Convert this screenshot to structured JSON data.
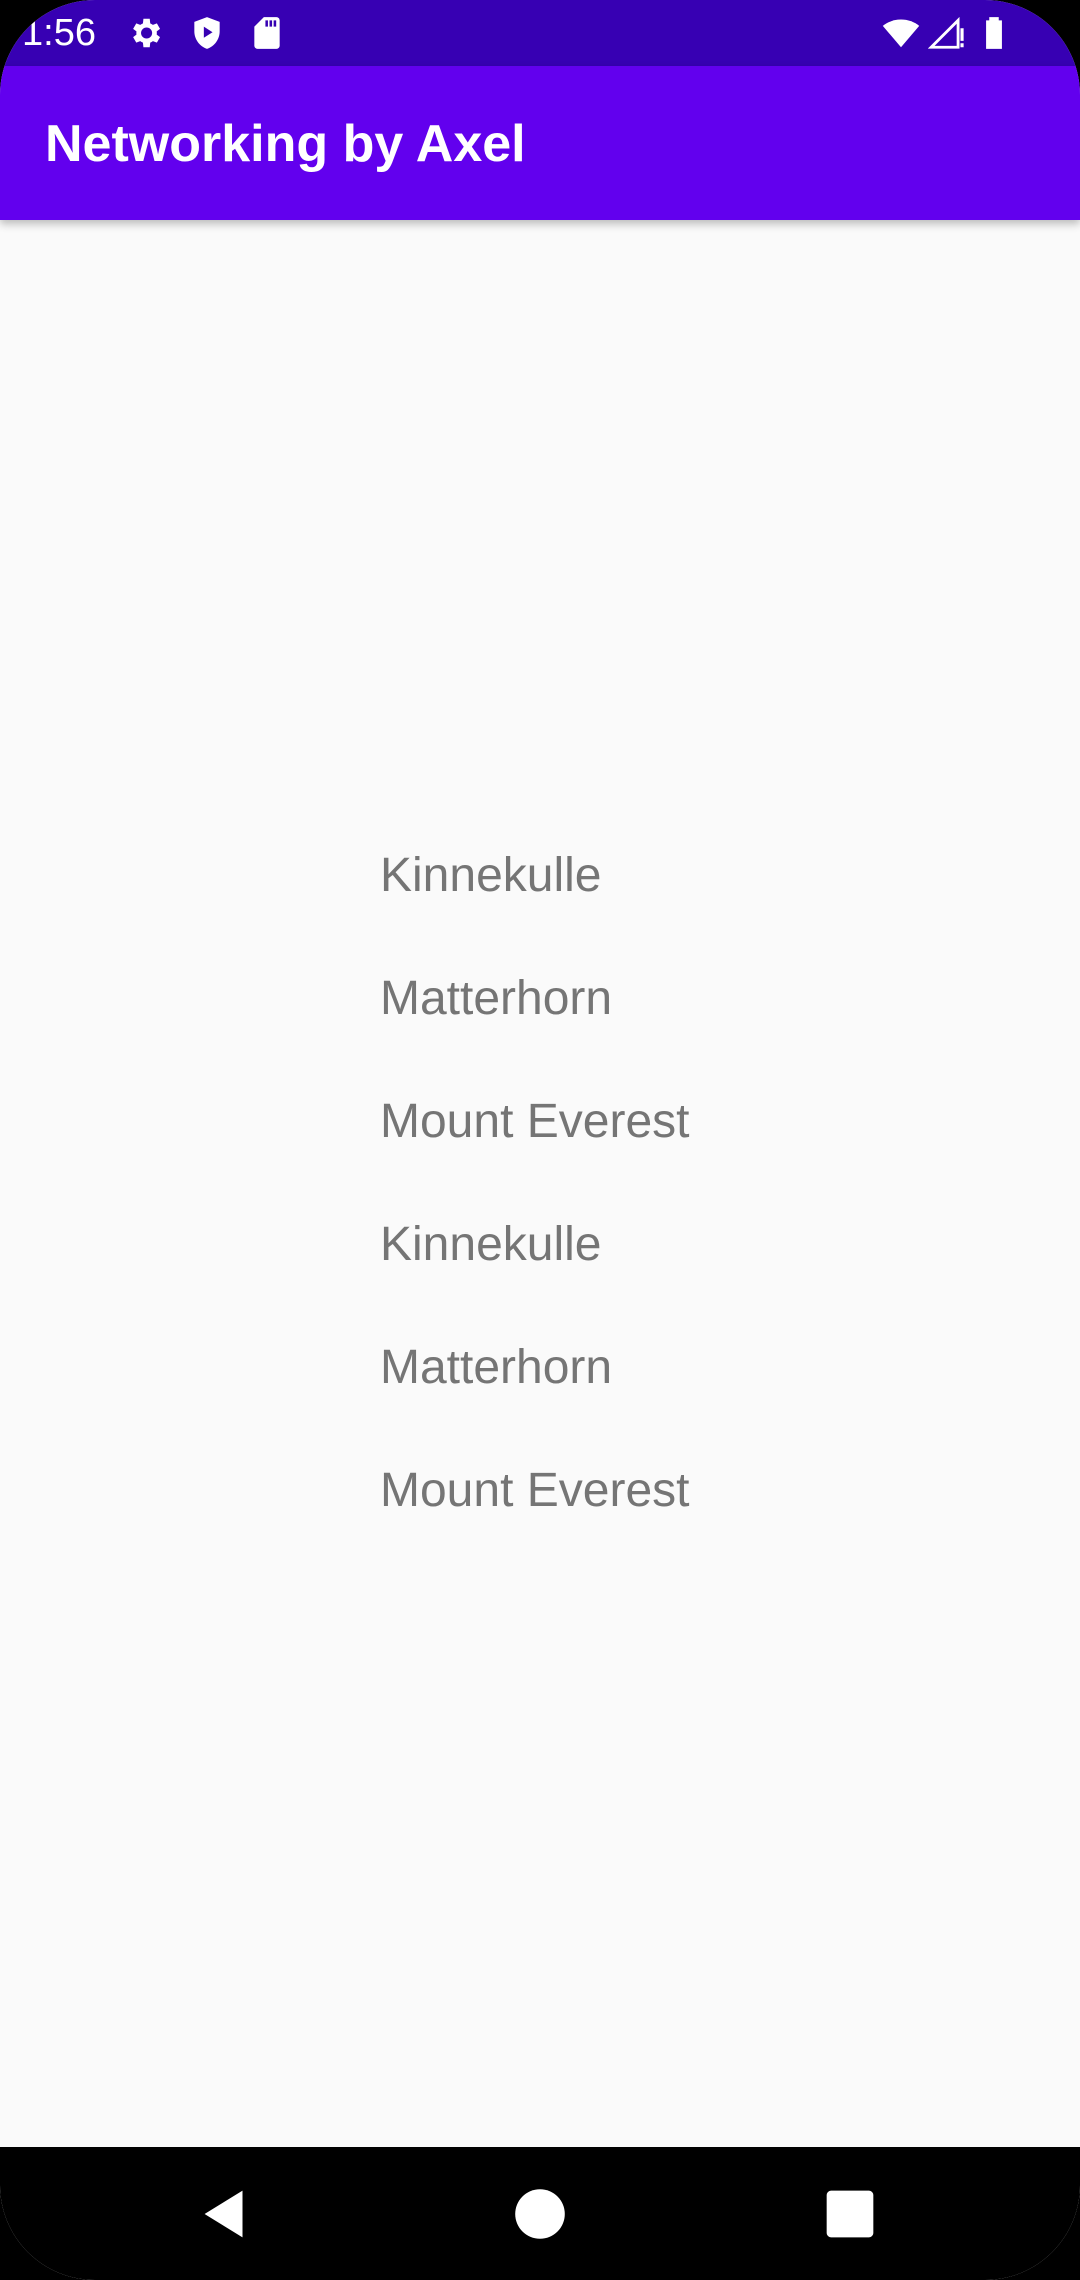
{
  "status_bar": {
    "time": "1:56",
    "icons_left": [
      "settings-icon",
      "shield-play-icon",
      "sd-card-icon"
    ],
    "icons_right": [
      "wifi-icon",
      "signal-icon",
      "battery-icon"
    ],
    "background": "#3700b3"
  },
  "app_bar": {
    "title": "Networking by Axel",
    "background": "#6200ee"
  },
  "list": {
    "items": [
      {
        "label": "Kinnekulle"
      },
      {
        "label": "Matterhorn"
      },
      {
        "label": "Mount Everest"
      },
      {
        "label": "Kinnekulle"
      },
      {
        "label": "Matterhorn"
      },
      {
        "label": "Mount Everest"
      }
    ]
  },
  "nav_bar": {
    "buttons": [
      "back-icon",
      "home-icon",
      "recents-icon"
    ]
  }
}
